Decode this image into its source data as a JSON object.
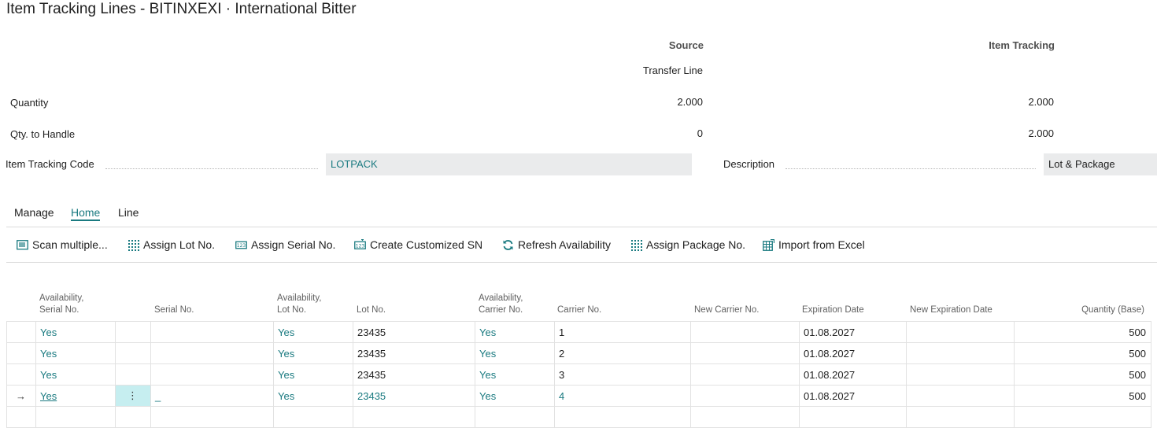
{
  "page": {
    "title": "Item Tracking Lines - BITINXEXI · International Bitter"
  },
  "summary": {
    "source_header": "Source",
    "tracking_header": "Item Tracking",
    "source_type": "Transfer Line",
    "quantity_label": "Quantity",
    "quantity_source": "2.000",
    "quantity_tracking": "2.000",
    "qty_handle_label": "Qty. to Handle",
    "qty_handle_source": "0",
    "qty_handle_tracking": "2.000",
    "tracking_code_label": "Item Tracking Code",
    "tracking_code_value": "LOTPACK",
    "description_label": "Description",
    "description_value": "Lot & Package"
  },
  "tabs": [
    {
      "label": "Manage"
    },
    {
      "label": "Home"
    },
    {
      "label": "Line"
    }
  ],
  "actions": [
    {
      "label": "Scan multiple...",
      "icon": "scan-icon"
    },
    {
      "label": "Assign Lot No.",
      "icon": "grid-icon"
    },
    {
      "label": "Assign Serial No.",
      "icon": "serial-icon"
    },
    {
      "label": "Create Customized SN",
      "icon": "custom-sn-icon"
    },
    {
      "label": "Refresh Availability",
      "icon": "refresh-icon"
    },
    {
      "label": "Assign Package No.",
      "icon": "grid-icon"
    },
    {
      "label": "Import from Excel",
      "icon": "excel-icon"
    }
  ],
  "columns": {
    "avail_serial_1": "Availability,",
    "avail_serial_2": "Serial No.",
    "serial": "Serial No.",
    "avail_lot_1": "Availability,",
    "avail_lot_2": "Lot No.",
    "lot": "Lot No.",
    "avail_carrier_1": "Availability,",
    "avail_carrier_2": "Carrier No.",
    "carrier": "Carrier No.",
    "new_carrier": "New Carrier No.",
    "expiration": "Expiration Date",
    "new_expiration": "New Expiration Date",
    "quantity": "Quantity (Base)"
  },
  "rows": [
    {
      "avail_serial": "Yes",
      "serial": "",
      "avail_lot": "Yes",
      "lot": "23435",
      "avail_carrier": "Yes",
      "carrier": "1",
      "new_carrier": "",
      "expiration": "01.08.2027",
      "new_expiration": "",
      "quantity": "500"
    },
    {
      "avail_serial": "Yes",
      "serial": "",
      "avail_lot": "Yes",
      "lot": "23435",
      "avail_carrier": "Yes",
      "carrier": "2",
      "new_carrier": "",
      "expiration": "01.08.2027",
      "new_expiration": "",
      "quantity": "500"
    },
    {
      "avail_serial": "Yes",
      "serial": "",
      "avail_lot": "Yes",
      "lot": "23435",
      "avail_carrier": "Yes",
      "carrier": "3",
      "new_carrier": "",
      "expiration": "01.08.2027",
      "new_expiration": "",
      "quantity": "500"
    },
    {
      "arrow": "→",
      "avail_serial": "Yes",
      "menu": "⋮",
      "serial": "_",
      "avail_lot": "Yes",
      "lot": "23435",
      "avail_carrier": "Yes",
      "carrier": "4",
      "new_carrier": "",
      "expiration": "01.08.2027",
      "new_expiration": "",
      "quantity": "500"
    }
  ],
  "colors": {
    "accent": "#1a7a80",
    "field_bg": "#eaebec",
    "selected_cell": "#c6eef0"
  }
}
